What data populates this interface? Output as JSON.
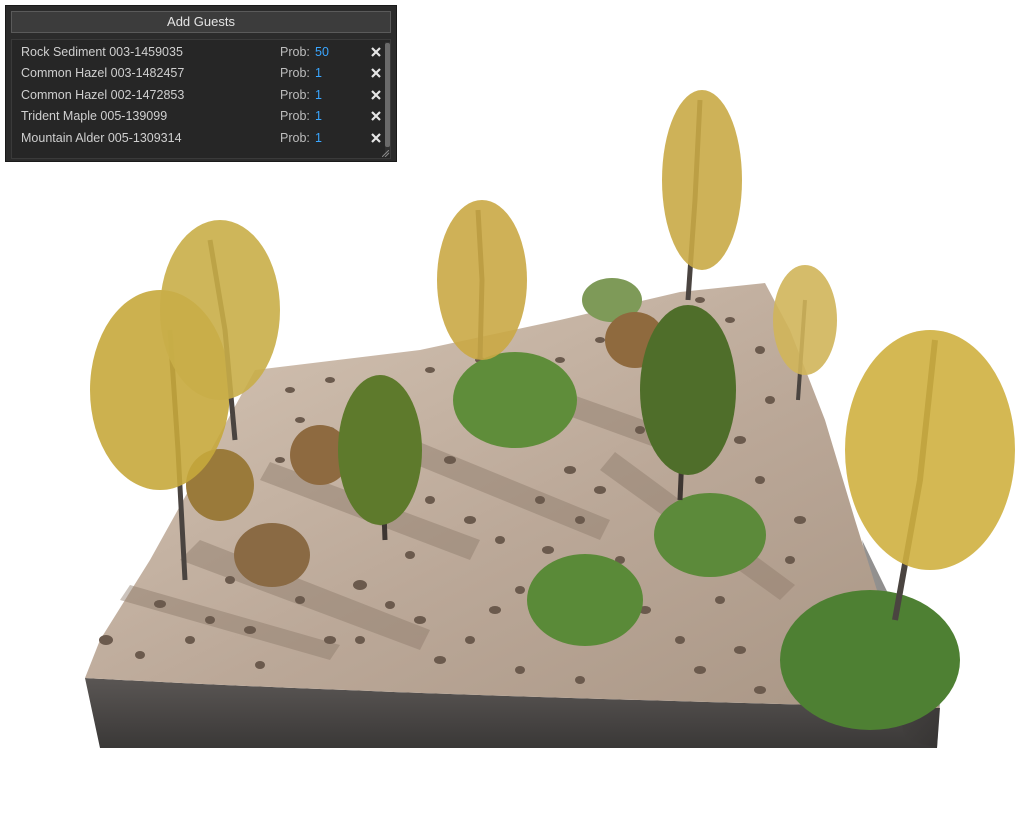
{
  "panel": {
    "add_button_label": "Add Guests",
    "prob_label": "Prob:",
    "items": [
      {
        "name": "Rock Sediment 003-1459035",
        "prob": "50"
      },
      {
        "name": "Common Hazel 003-1482457",
        "prob": "1"
      },
      {
        "name": "Common Hazel 002-1472853",
        "prob": "1"
      },
      {
        "name": "Trident Maple 005-139099",
        "prob": "1"
      },
      {
        "name": "Mountain Alder 005-1309314",
        "prob": "1"
      }
    ],
    "delete_icon": "close-icon"
  },
  "scene": {
    "colors": {
      "ground_top": "#c2ae9c",
      "ground_side": "#4a4746",
      "tree_foliage": "#c7a83c",
      "shrub_green": "#5e8a3a",
      "rock": "#6a5a4e"
    }
  }
}
